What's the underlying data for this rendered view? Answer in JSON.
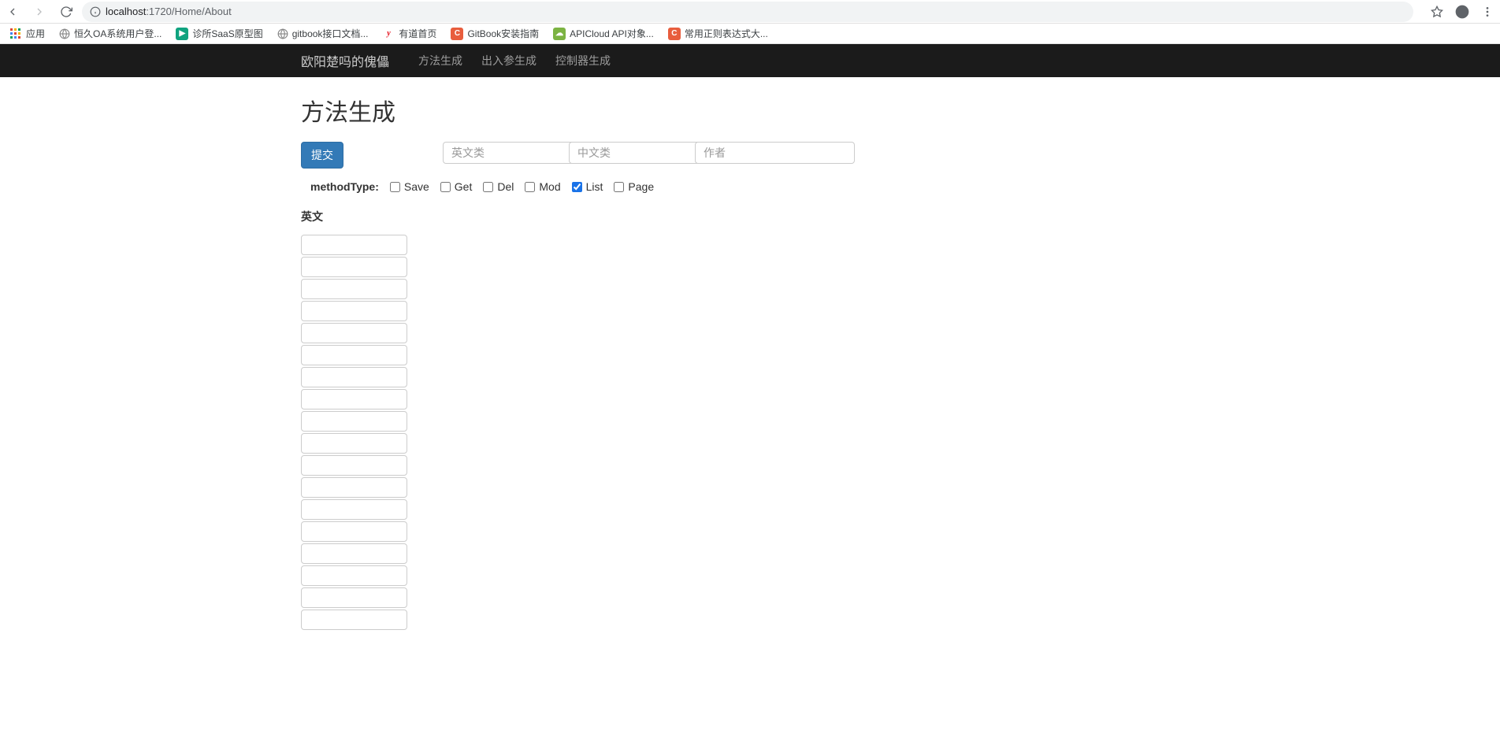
{
  "browser": {
    "url": "localhost:1720/Home/About",
    "url_prefix": "localhost",
    "url_suffix": ":1720/Home/About"
  },
  "bookmarks": [
    {
      "label": "应用",
      "icon_bg": "",
      "icon_type": "apps"
    },
    {
      "label": "恒久OA系统用户登...",
      "icon_bg": "#888",
      "icon_type": "globe"
    },
    {
      "label": "诊所SaaS原型图",
      "icon_bg": "#10a37f",
      "icon_type": "play"
    },
    {
      "label": "gitbook接口文档...",
      "icon_bg": "#888",
      "icon_type": "globe"
    },
    {
      "label": "有道首页",
      "icon_bg": "#e30613",
      "icon_type": "y"
    },
    {
      "label": "GitBook安装指南",
      "icon_bg": "#e85d3d",
      "icon_type": "c"
    },
    {
      "label": "APICloud API对象...",
      "icon_bg": "#7cb342",
      "icon_type": "api"
    },
    {
      "label": "常用正则表达式大...",
      "icon_bg": "#e85d3d",
      "icon_type": "c"
    }
  ],
  "navbar": {
    "brand": "欧阳楚吗的傀儡",
    "links": [
      {
        "label": "方法生成"
      },
      {
        "label": "出入参生成"
      },
      {
        "label": "控制器生成"
      }
    ]
  },
  "page": {
    "title": "方法生成",
    "submit_label": "提交",
    "english_class_placeholder": "英文类",
    "chinese_class_placeholder": "中文类",
    "author_placeholder": "作者"
  },
  "methodType": {
    "label": "methodType:",
    "options": [
      {
        "label": "Save",
        "checked": false
      },
      {
        "label": "Get",
        "checked": false
      },
      {
        "label": "Del",
        "checked": false
      },
      {
        "label": "Mod",
        "checked": false
      },
      {
        "label": "List",
        "checked": true
      },
      {
        "label": "Page",
        "checked": false
      }
    ]
  },
  "english_section": {
    "label": "英文",
    "input_count": 18
  }
}
